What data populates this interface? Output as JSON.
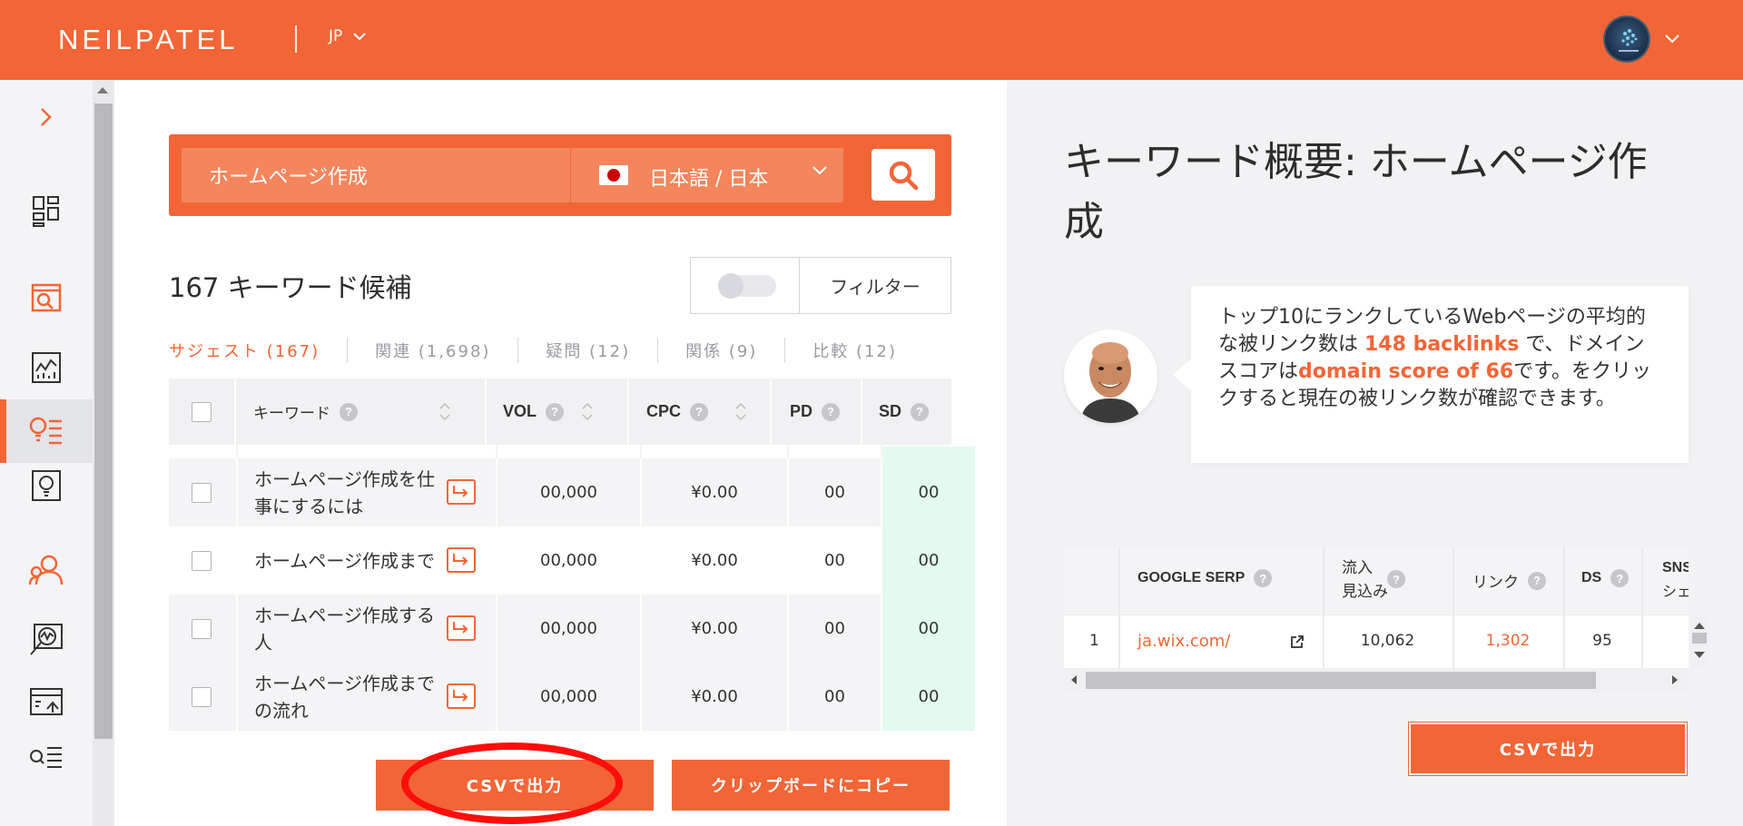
{
  "header": {
    "logo": "NEILPATEL",
    "language": "JP"
  },
  "search": {
    "query": "ホームページ作成",
    "language_label": "日本語 / 日本"
  },
  "results": {
    "count_label": "167 キーワード候補",
    "filter_label": "フィルター"
  },
  "tabs": [
    {
      "label": "サジェスト (167)",
      "active": true
    },
    {
      "label": "関連 (1,698)",
      "active": false
    },
    {
      "label": "疑問 (12)",
      "active": false
    },
    {
      "label": "関係 (9)",
      "active": false
    },
    {
      "label": "比較 (12)",
      "active": false
    }
  ],
  "table": {
    "headers": {
      "keyword": "キーワード",
      "vol": "VOL",
      "cpc": "CPC",
      "pd": "PD",
      "sd": "SD"
    },
    "rows": [
      {
        "keyword": "ホームページ作成を仕事にするには",
        "vol": "00,000",
        "cpc": "¥0.00",
        "pd": "00",
        "sd": "00"
      },
      {
        "keyword": "ホームページ作成まで",
        "vol": "00,000",
        "cpc": "¥0.00",
        "pd": "00",
        "sd": "00"
      },
      {
        "keyword": "ホームページ作成する人",
        "vol": "00,000",
        "cpc": "¥0.00",
        "pd": "00",
        "sd": "00"
      },
      {
        "keyword": "ホームページ作成までの流れ",
        "vol": "00,000",
        "cpc": "¥0.00",
        "pd": "00",
        "sd": "00"
      }
    ]
  },
  "buttons": {
    "csv": "CSVで出力",
    "clipboard": "クリップボードにコピー",
    "csv_right": "CSVで出力"
  },
  "overview": {
    "title": "キーワード概要: ホームページ作成",
    "bubble_pre": "トップ10にランクしているWebページの平均的な被リンク数は ",
    "bubble_backlinks": "148 backlinks",
    "bubble_mid": " で、ドメインスコアは",
    "bubble_domain": "domain score of 66",
    "bubble_post": "です。をクリックすると現在の被リンク数が確認できます。"
  },
  "serp": {
    "headers": {
      "serp": "GOOGLE SERP",
      "traffic": "流入\n見込み",
      "links": "リンク",
      "ds": "DS",
      "sns": "SNS",
      "sns2": "シェ"
    },
    "rows": [
      {
        "rank": "1",
        "url": "ja.wix.com/",
        "traffic": "10,062",
        "links": "1,302",
        "ds": "95"
      }
    ]
  },
  "colors": {
    "accent": "#f26536",
    "sd_green": "#e2fbee",
    "highlight_red": "#ff0d0d"
  },
  "icons": [
    "chevron-down-icon",
    "search-icon",
    "help-icon",
    "sort-icon",
    "external-link-icon",
    "sidebar-expand-icon",
    "dashboard-icon",
    "traffic-analyzer-icon",
    "site-audit-icon",
    "keyword-ideas-icon",
    "content-ideas-icon",
    "backlinks-icon",
    "rank-tracking-icon",
    "seo-analyzer-icon",
    "keyword-list-icon"
  ]
}
